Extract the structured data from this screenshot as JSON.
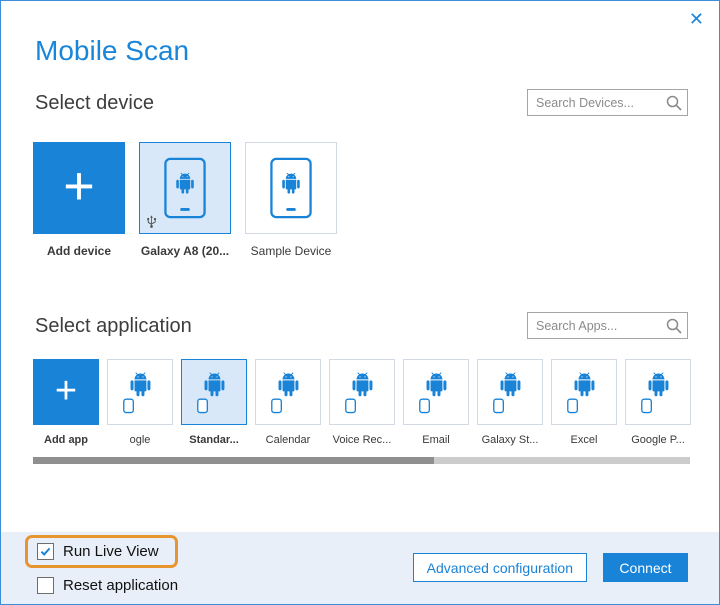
{
  "icons": {
    "close": "✕",
    "plus": "+"
  },
  "colors": {
    "accent": "#1883d7",
    "selected_tile_bg": "#d9e8f8",
    "footer_bg": "#e8eff9",
    "highlight_orange": "#e7962f"
  },
  "dialog": {
    "title": "Mobile Scan"
  },
  "device_section": {
    "heading": "Select device",
    "search_placeholder": "Search Devices...",
    "tiles": [
      {
        "label": "Add device",
        "type": "add"
      },
      {
        "label": "Galaxy A8 (20...",
        "type": "device",
        "selected": true,
        "usb_connected": true
      },
      {
        "label": "Sample Device",
        "type": "device",
        "selected": false
      }
    ]
  },
  "app_section": {
    "heading": "Select application",
    "search_placeholder": "Search Apps...",
    "tiles": [
      {
        "label": "Add app",
        "type": "add"
      },
      {
        "label": "ogle",
        "type": "app",
        "selected": false
      },
      {
        "label": "Standar...",
        "type": "app",
        "selected": true
      },
      {
        "label": "Calendar",
        "type": "app",
        "selected": false
      },
      {
        "label": "Voice Rec...",
        "type": "app",
        "selected": false
      },
      {
        "label": "Email",
        "type": "app",
        "selected": false
      },
      {
        "label": "Galaxy St...",
        "type": "app",
        "selected": false
      },
      {
        "label": "Excel",
        "type": "app",
        "selected": false
      },
      {
        "label": "Google P...",
        "type": "app",
        "selected": false
      }
    ]
  },
  "footer": {
    "run_live_view": {
      "label": "Run Live View",
      "checked": true
    },
    "reset_application": {
      "label": "Reset application",
      "checked": false
    },
    "advanced_button": "Advanced configuration",
    "connect_button": "Connect"
  }
}
